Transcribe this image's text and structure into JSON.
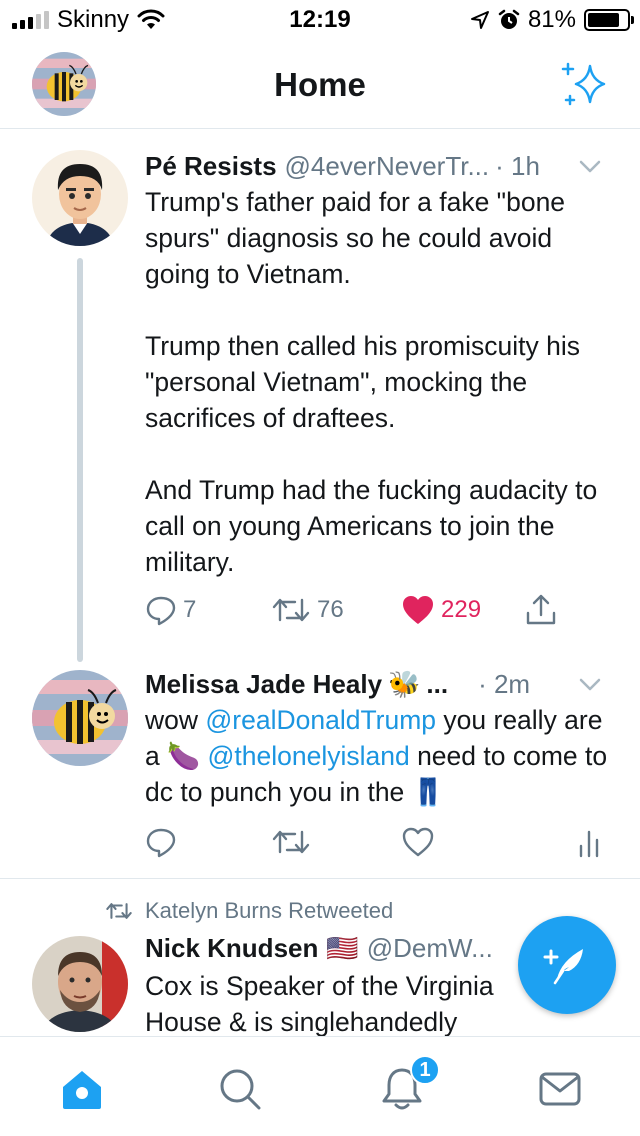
{
  "status_bar": {
    "carrier": "Skinny",
    "time": "12:19",
    "battery_percent": "81%",
    "battery_level": 0.81,
    "signal_bars_active": 3,
    "signal_bars_total": 5
  },
  "header": {
    "title": "Home",
    "avatar_icon": "bee-avatar",
    "right_icon": "sparkle-icon"
  },
  "tweets": [
    {
      "name": "Pé Resists",
      "handle": "@4everNeverTr...",
      "time": "· 1h",
      "body": "Trump's father paid for a fake \"bone spurs\" diagnosis so he could avoid going to Vietnam.\n\nTrump then called his promiscuity his \"personal Vietnam\", mocking the sacrifices of draftees.\n\nAnd Trump had the fucking audacity to call on young Americans to join the military.",
      "replies": "7",
      "retweets": "76",
      "likes": "229"
    },
    {
      "name": "Melissa Jade Healy",
      "name_emoji": "🐝",
      "handle": "...",
      "time": "· 2m",
      "body_parts": {
        "p1": "wow ",
        "mention1": "@realDonaldTrump",
        "p2": " you really are a ",
        "emoji1": "🍆",
        "p3": " ",
        "mention2": "@thelonelyisland",
        "p4": " need to come to dc to punch you in the ",
        "emoji2": "👖"
      }
    },
    {
      "retweeted_by": "Katelyn Burns Retweeted",
      "name": "Nick Knudsen",
      "name_emoji": "🇺🇸",
      "handle": "@DemW...",
      "body": "Cox is Speaker of the Virginia\nHouse & is singlehandedly"
    }
  ],
  "tabbar": {
    "notification_badge": "1",
    "tabs": [
      "home-icon",
      "search-icon",
      "notifications-icon",
      "messages-icon"
    ]
  },
  "colors": {
    "accent": "#1da1f2",
    "like": "#e0245e",
    "muted": "#657786",
    "mention": "#1b95e0"
  }
}
